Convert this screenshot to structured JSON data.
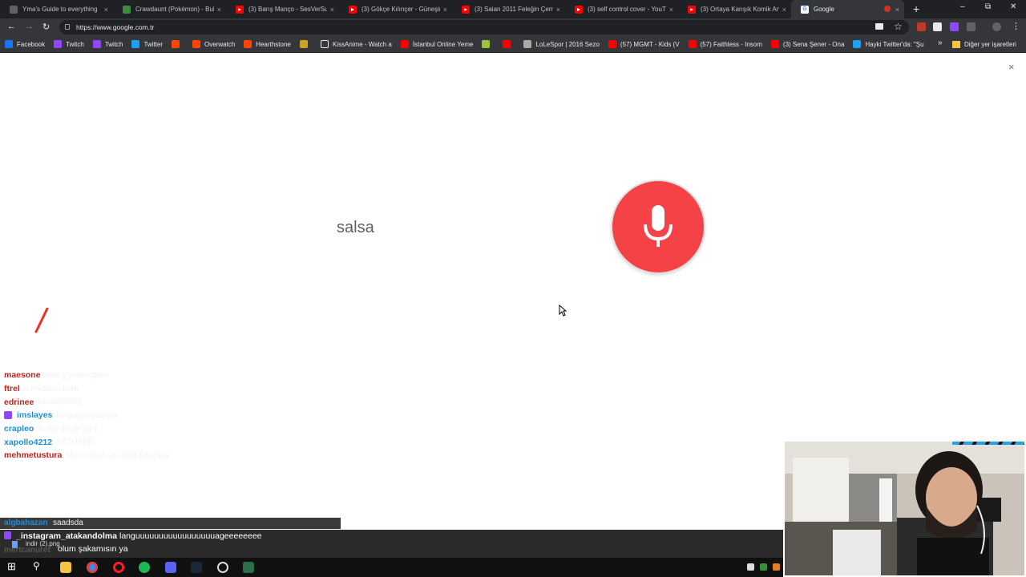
{
  "browser": {
    "tabs": [
      {
        "title": "Yma's Guide to everything",
        "icon": "globe-icon",
        "active": false
      },
      {
        "title": "Crawdaunt (Pokémon) - Bul",
        "icon": "leaf-icon",
        "active": false
      },
      {
        "title": "(3) Barış Manço - SesVerSu",
        "icon": "youtube-icon",
        "active": false
      },
      {
        "title": "(3) Gökçe Kılınçer - Güneşin",
        "icon": "youtube-icon",
        "active": false
      },
      {
        "title": "(3) Saian 2011 Feleğin Çem",
        "icon": "youtube-icon",
        "active": false
      },
      {
        "title": "(3) self control cover - YouT",
        "icon": "youtube-icon",
        "active": false
      },
      {
        "title": "(3) Ortaya Karışık Komik An",
        "icon": "youtube-icon",
        "active": false
      },
      {
        "title": "Google",
        "icon": "google-icon",
        "active": true
      }
    ],
    "tab_close": "×",
    "new_tab": "+",
    "url": "https://www.google.com.tr",
    "bookmarks": [
      {
        "label": "Facebook",
        "icon": "facebook-icon"
      },
      {
        "label": "Twitch",
        "icon": "twitch-icon"
      },
      {
        "label": "Twitch",
        "icon": "twitch-icon"
      },
      {
        "label": "Twitter",
        "icon": "twitter-icon"
      },
      {
        "label": "",
        "icon": "reddit-icon"
      },
      {
        "label": "Overwatch",
        "icon": "reddit-icon"
      },
      {
        "label": "Hearthstone",
        "icon": "reddit-icon"
      },
      {
        "label": "",
        "icon": "bookmark-icon"
      },
      {
        "label": "KissAnime - Watch a",
        "icon": "page-icon"
      },
      {
        "label": "İstanbul Online Yeme",
        "icon": "bookmark-icon"
      },
      {
        "label": "",
        "icon": "bookmark-icon"
      },
      {
        "label": "",
        "icon": "youtube-icon"
      },
      {
        "label": "LoLeSpor | 2016 Sezo",
        "icon": "bookmark-icon"
      },
      {
        "label": "(57) MGMT - Kids (V",
        "icon": "youtube-icon"
      },
      {
        "label": "(57) Faithless - Insom",
        "icon": "youtube-icon"
      },
      {
        "label": "(3) Sena Şener - Ona",
        "icon": "youtube-icon"
      },
      {
        "label": "Hayki Twitter'da: \"Şu",
        "icon": "twitter-icon"
      }
    ],
    "bookmarks_more": "»",
    "other_bookmarks": "Diğer yer işaretleri"
  },
  "page": {
    "close": "×",
    "transcript": "salsa"
  },
  "chat": {
    "lines": [
      {
        "user": "maesone",
        "color": "#c0231b",
        "msg": "oom y yapervpara"
      },
      {
        "user": "ftrel",
        "color": "#c0231b",
        "msg": "o erkeksin bers"
      },
      {
        "user": "edrinee",
        "color": "#c0231b",
        "msg": "wiiiiiki{3000}"
      },
      {
        "user": "imslayes",
        "color": "#1e8fd6",
        "msg": "language yazıyor",
        "badge": true
      },
      {
        "user": "crapleo",
        "color": "#1e8fd6",
        "msg": "w dijy do pe pp o"
      },
      {
        "user": "xapollo4212",
        "color": "#1e8fd6",
        "msg": "YETHEER"
      },
      {
        "user": "mehmetustura",
        "color": "#c0231b",
        "msg": "show more var orda basesns"
      }
    ],
    "input_user": "algbahazan",
    "input_msg": "saadsda"
  },
  "overlay": {
    "user1": "_instagram_atakandolma",
    "msg1": "languuuuuuuuuuuuuuuuuageeeeeeee",
    "file": "indir (2).png",
    "user2": "mertcanuret",
    "msg2": "olum şakamısın ya"
  },
  "colors": {
    "mic": "#f44246",
    "chrome_dark": "#202124",
    "chrome_mid": "#35363a"
  }
}
